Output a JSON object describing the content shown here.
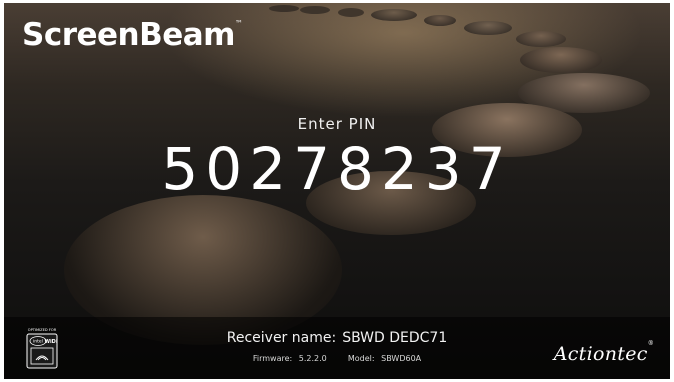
{
  "brand": {
    "name": "ScreenBeam",
    "trademark": "™"
  },
  "pin": {
    "label": "Enter PIN",
    "value": "50278237"
  },
  "receiver": {
    "name_label": "Receiver name:",
    "name_value": "SBWD DEDC71",
    "firmware_label": "Firmware:",
    "firmware_value": "5.2.2.0",
    "model_label": "Model:",
    "model_value": "SBWD60A"
  },
  "widi_badge": {
    "caption": "OPTIMIZED FOR",
    "brand": "intel",
    "product": "WiDi",
    "icon": "intel-widi-logo"
  },
  "manufacturer": {
    "name": "Actiontec",
    "trademark": "®"
  },
  "colors": {
    "background_top": "#4a3e34",
    "background_bottom": "#0e0d0c",
    "text": "#ffffff"
  }
}
